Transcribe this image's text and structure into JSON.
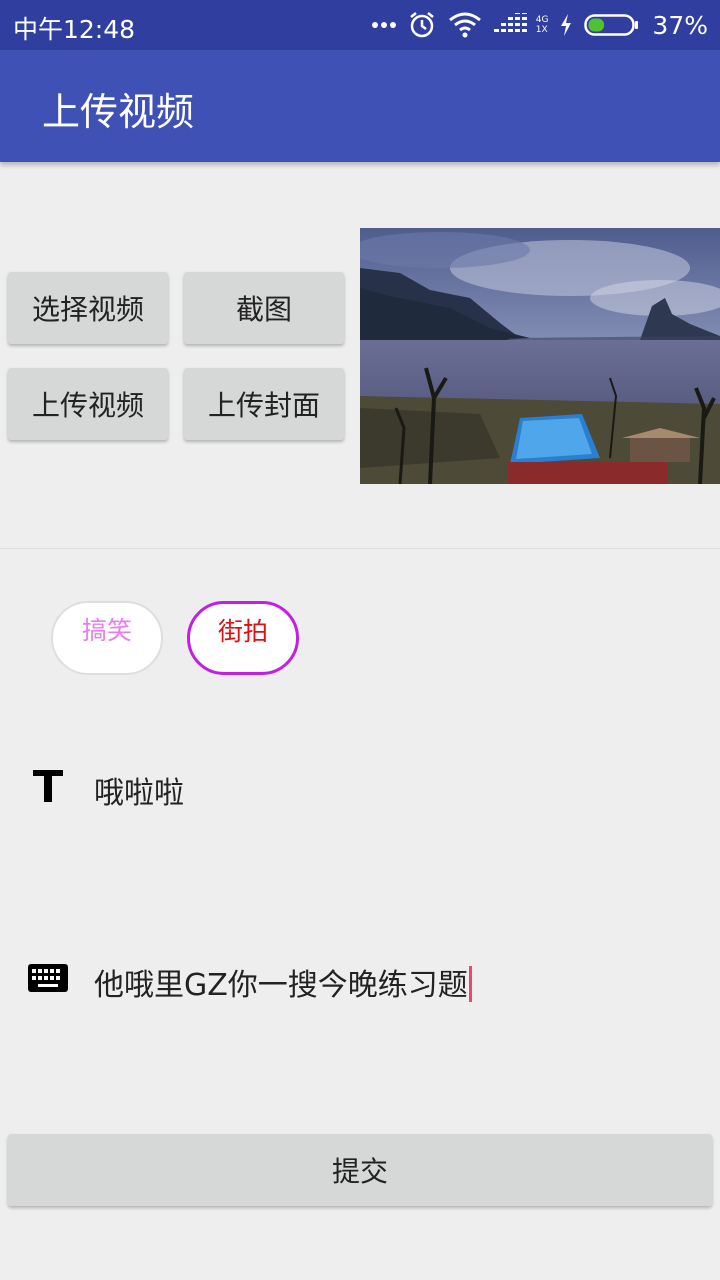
{
  "status_bar": {
    "time": "中午12:48",
    "battery_percent": "37%",
    "battery_level": 0.37,
    "network_label": "4G",
    "network_sub": "1X",
    "icons": [
      "more-dots-icon",
      "alarm-icon",
      "wifi-icon",
      "signal-icon",
      "charging-icon",
      "battery-icon"
    ]
  },
  "app_bar": {
    "title": "上传视频"
  },
  "actions": {
    "select_video": "选择视频",
    "screenshot": "截图",
    "upload_video": "上传视频",
    "upload_cover": "上传封面"
  },
  "tags": [
    {
      "label": "搞笑",
      "selected": false
    },
    {
      "label": "街拍",
      "selected": true
    }
  ],
  "title_field": {
    "value": "哦啦啦",
    "icon": "text-format-icon"
  },
  "description_field": {
    "value": "他哦里GZ你一搜今晚练习题",
    "icon": "keyboard-icon"
  },
  "submit_label": "提交",
  "colors": {
    "status_bar": "#303f9f",
    "app_bar": "#3f51b5",
    "background": "#eeeeee",
    "button": "#d6d7d7",
    "chip_selected_border": "#c11ee6",
    "chip_selected_text": "#e01010",
    "chip_text": "#e97df0",
    "caret": "#e64a6f"
  }
}
